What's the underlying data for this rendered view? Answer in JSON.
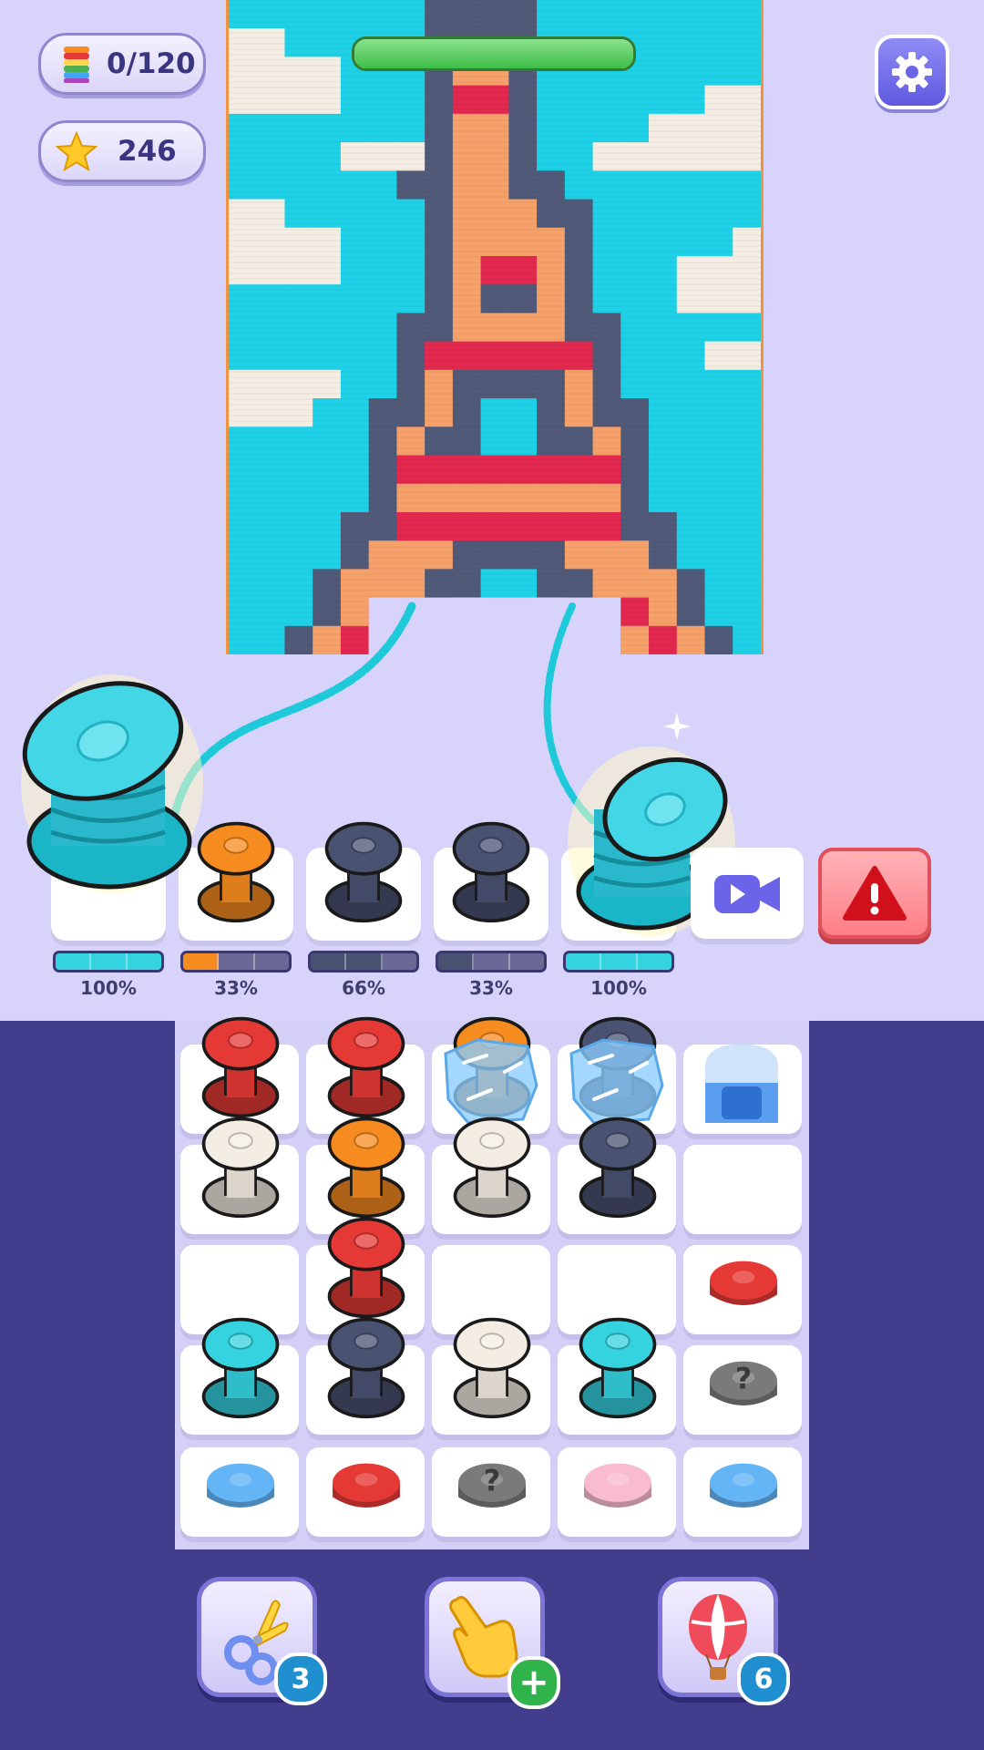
{
  "hud": {
    "spool_count": "0/120",
    "stars": "246",
    "settings_icon": "gear-icon",
    "level_progress": 1.0
  },
  "colors": {
    "background": "#d8d3fb",
    "board": "#433d8e",
    "cyan": "#35d2e0",
    "orange": "#f68b1f",
    "red": "#e53935",
    "navy": "#4a5272",
    "cream": "#f4ede3",
    "blue": "#64b5f6",
    "pink": "#f8bbd0",
    "gray": "#7a7a7a"
  },
  "picture": {
    "subject": "eiffel-tower-knit",
    "cols": 19,
    "rows": 23,
    "palette": {
      "c": "#1ed1e6",
      "w": "#f4ede3",
      "g": "#505a78",
      "o": "#f6a06a",
      "r": "#e3284f"
    },
    "grid": [
      "cccccccggggcccccccc",
      "wwcccccggggcccccccc",
      "wwwwcccgoogcccccccc",
      "wwwwcccgrrgccccccww",
      "cccccccgoogccccwwww",
      "ccccwwwgoogccwwwwww",
      "ccccccggooggccccccc",
      "wwcccccgoooggcccccc",
      "wwwwcccgoooogcccccw",
      "wwwwcccgorrogcccwww",
      "cccccccgoggogcccwww",
      "ccccccggooooggccccc",
      "ccccccgrrrrrrgcccww",
      "wwwwccgoggggogccccc",
      "wwwccggogccgoggcccc",
      "cccccgoggccggogcccc",
      "cccccgrrrrrrrrgcccc",
      "cccccgoooooooogcccc",
      "ccccggrrrrrrrrggccc",
      "ccccgoooggggooogccc",
      "cccgoooggccggooogcc",
      "cccgorrgccccgrrogcc",
      "ccgoroggccccggorogc"
    ]
  },
  "top_slots": [
    {
      "percent": "100%",
      "color": "#35d2e0",
      "fill": 1.0,
      "state": "big-spool"
    },
    {
      "percent": "33%",
      "color": "#f68b1f",
      "fill": 0.33,
      "state": "spool"
    },
    {
      "percent": "66%",
      "color": "#4a5272",
      "fill": 0.66,
      "state": "spool"
    },
    {
      "percent": "33%",
      "color": "#4a5272",
      "fill": 0.33,
      "state": "spool"
    },
    {
      "percent": "100%",
      "color": "#35d2e0",
      "fill": 1.0,
      "state": "big-spool"
    }
  ],
  "board_rows": [
    [
      {
        "t": "spool",
        "c": "#e53935"
      },
      {
        "t": "spool",
        "c": "#e53935"
      },
      {
        "t": "frozen",
        "c": "#f68b1f"
      },
      {
        "t": "frozen",
        "c": "#4a5272"
      },
      {
        "t": "dispenser",
        "c": "#64b5f6"
      }
    ],
    [
      {
        "t": "spool",
        "c": "#f4ede3"
      },
      {
        "t": "spool",
        "c": "#f68b1f"
      },
      {
        "t": "spool",
        "c": "#f4ede3"
      },
      {
        "t": "spool",
        "c": "#4a5272"
      },
      {
        "t": "empty"
      }
    ],
    [
      {
        "t": "empty"
      },
      {
        "t": "spool",
        "c": "#e53935"
      },
      {
        "t": "empty"
      },
      {
        "t": "empty"
      },
      {
        "t": "cap",
        "c": "#e53935"
      }
    ],
    [
      {
        "t": "spool",
        "c": "#35d2e0"
      },
      {
        "t": "spool",
        "c": "#4a5272"
      },
      {
        "t": "spool",
        "c": "#f4ede3"
      },
      {
        "t": "spool",
        "c": "#35d2e0"
      },
      {
        "t": "mystery",
        "c": "#7a7a7a"
      }
    ],
    [
      {
        "t": "cap",
        "c": "#64b5f6"
      },
      {
        "t": "cap",
        "c": "#e53935"
      },
      {
        "t": "mystery",
        "c": "#7a7a7a"
      },
      {
        "t": "cap",
        "c": "#f8bbd0"
      },
      {
        "t": "cap",
        "c": "#64b5f6"
      }
    ]
  ],
  "boosters": [
    {
      "icon": "scissors-icon",
      "count": "3"
    },
    {
      "icon": "pointing-hand-icon",
      "count": "+"
    },
    {
      "icon": "hot-air-balloon-icon",
      "count": "6"
    }
  ],
  "side_buttons": {
    "video_icon": "video-camera-icon",
    "alert_icon": "warning-icon"
  }
}
